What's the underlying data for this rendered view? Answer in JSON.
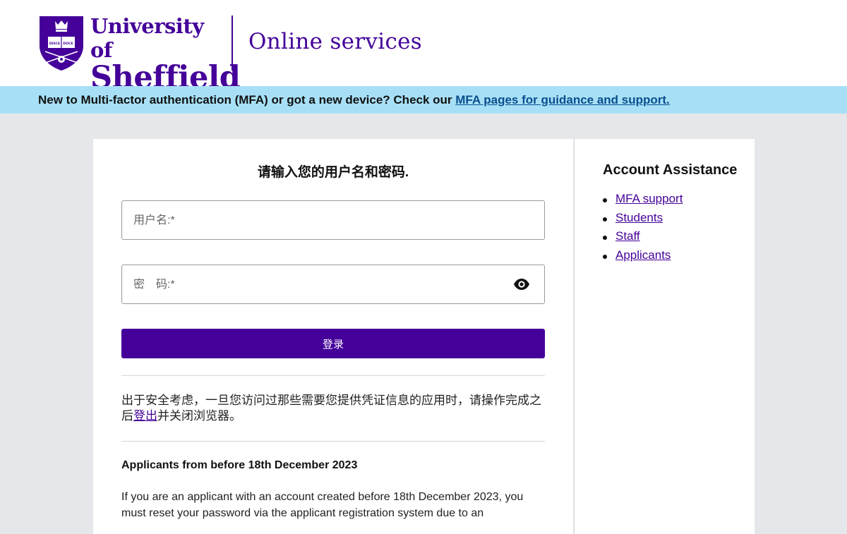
{
  "header": {
    "university_line1": "University of",
    "university_line2": "Sheffield",
    "service_title": "Online services",
    "crest_text": "DISCE DOCE"
  },
  "banner": {
    "text": "New to Multi-factor authentication (MFA) or got a new device? Check our ",
    "link_label": "MFA pages for guidance and support."
  },
  "login": {
    "heading": "请输入您的用户名和密码.",
    "username_placeholder": "用户名:*",
    "password_placeholder": "密　码:*",
    "submit_label": "登录",
    "security_before": "出于安全考虑，一旦您访问过那些需要您提供凭证信息的应用时，请操作完成之后",
    "security_link": "登出",
    "security_after": "并关闭浏览器。"
  },
  "applicants": {
    "title": "Applicants from before 18th December 2023",
    "body": "If you are an applicant with an account created before 18th December 2023, you must reset your password via the applicant registration system due to an"
  },
  "sidebar": {
    "title": "Account Assistance",
    "links": [
      {
        "label": "MFA support"
      },
      {
        "label": "Students"
      },
      {
        "label": "Staff"
      },
      {
        "label": "Applicants"
      }
    ]
  },
  "colors": {
    "brand_purple": "#440099",
    "banner_blue": "#a7e0f6",
    "page_bg": "#e6e7ea"
  }
}
